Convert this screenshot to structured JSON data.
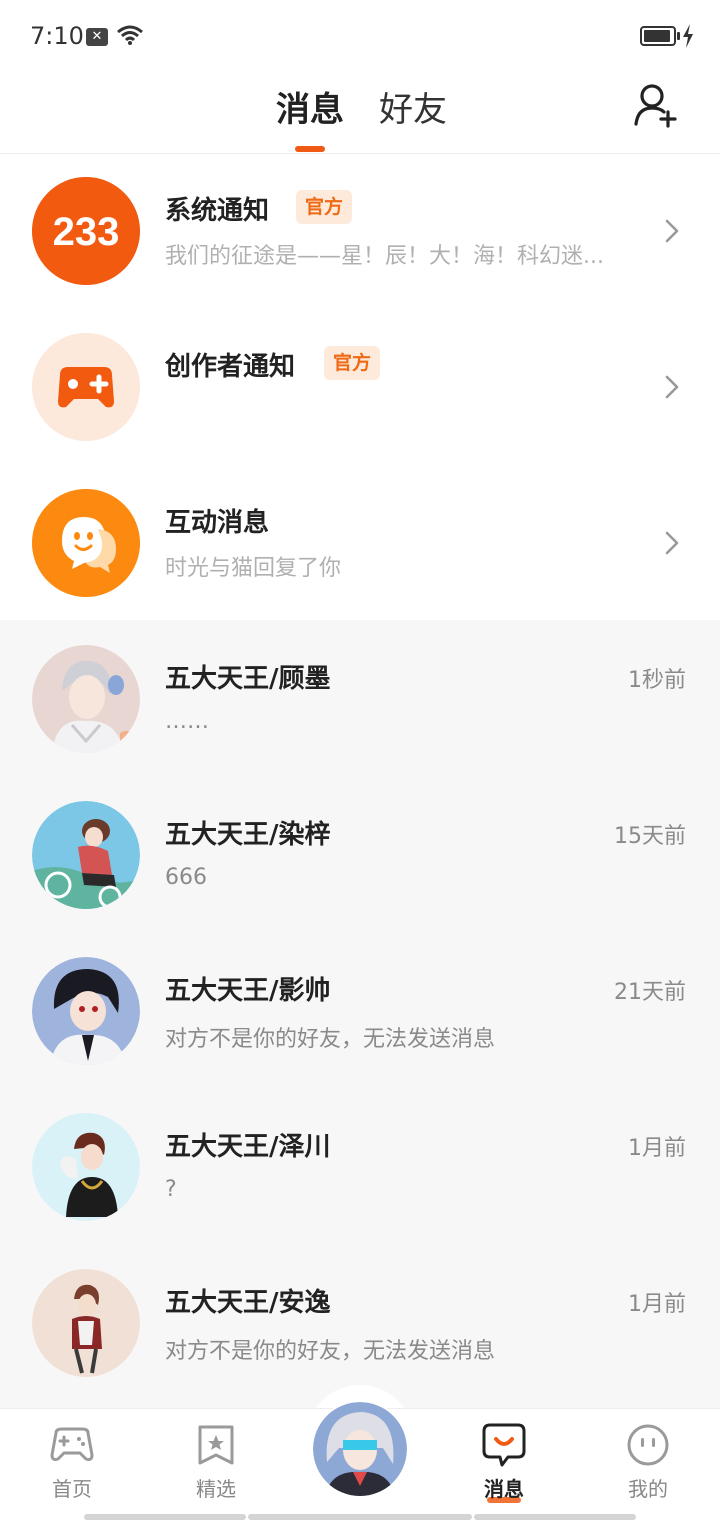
{
  "status": {
    "time": "7:10"
  },
  "header": {
    "tabs": [
      {
        "label": "消息",
        "active": true
      },
      {
        "label": "好友",
        "active": false
      }
    ]
  },
  "system_items": [
    {
      "title": "系统通知",
      "badge": "官方",
      "subtitle": "我们的征途是——星！辰！大！海！科幻迷...",
      "icon": "logo-233-icon",
      "avatar_text": "233"
    },
    {
      "title": "创作者通知",
      "badge": "官方",
      "subtitle": "",
      "icon": "gamepad-plus-icon"
    },
    {
      "title": "互动消息",
      "badge": "",
      "subtitle": "时光与猫回复了你",
      "icon": "chat-bubble-face-icon"
    }
  ],
  "friends": [
    {
      "name": "五大天王/顾墨",
      "time": "1秒前",
      "message": "……"
    },
    {
      "name": "五大天王/染梓",
      "time": "15天前",
      "message": "666"
    },
    {
      "name": "五大天王/影帅",
      "time": "21天前",
      "message": "对方不是你的好友，无法发送消息"
    },
    {
      "name": "五大天王/泽川",
      "time": "1月前",
      "message": "?"
    },
    {
      "name": "五大天王/安逸",
      "time": "1月前",
      "message": "对方不是你的好友，无法发送消息"
    }
  ],
  "bottom_nav": [
    {
      "label": "首页",
      "icon": "gamepad-icon",
      "active": false
    },
    {
      "label": "精选",
      "icon": "star-bookmark-icon",
      "active": false
    },
    {
      "label": "",
      "icon": "center-avatar",
      "active": false
    },
    {
      "label": "消息",
      "icon": "message-bubble-icon",
      "active": true
    },
    {
      "label": "我的",
      "icon": "smiley-face-icon",
      "active": false
    }
  ],
  "colors": {
    "accent": "#f05a14",
    "badge_bg": "#fdeadb",
    "badge_text": "#ee6a14",
    "friend_bg": "#f7f7f7"
  }
}
